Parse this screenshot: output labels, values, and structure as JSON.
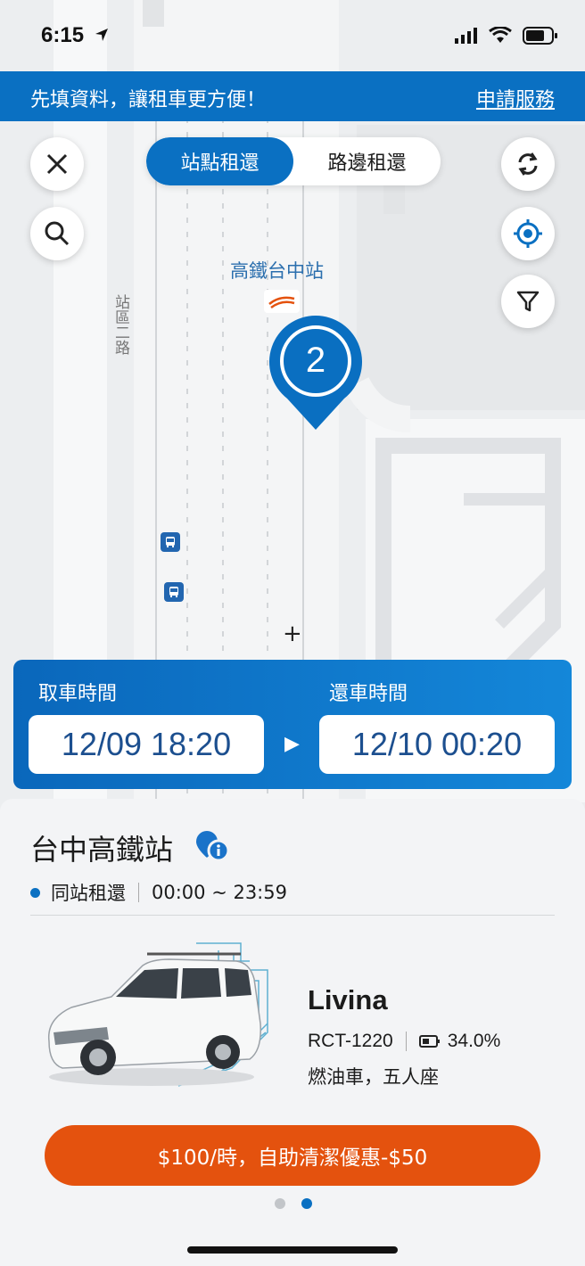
{
  "status_bar": {
    "time": "6:15"
  },
  "banner": {
    "message": "先填資料，讓租車更方便！",
    "link": "申請服務"
  },
  "segmented": {
    "option1": "站點租還",
    "option2": "路邊租還"
  },
  "map": {
    "station_label": "高鐵台中站",
    "road_label": "站區二路",
    "cluster_count": "2"
  },
  "time_bar": {
    "pickup_label": "取車時間",
    "pickup_value": "12/09 18:20",
    "return_label": "還車時間",
    "return_value": "12/10 00:20"
  },
  "station": {
    "name": "台中高鐵站",
    "mode": "同站租還",
    "hours": "00:00 ~ 23:59"
  },
  "car": {
    "model": "Livina",
    "plate": "RCT-1220",
    "battery": "34.0%",
    "description": "燃油車，五人座"
  },
  "promo": {
    "label": "$100/時，自助清潔優惠-$50"
  },
  "pager": {
    "total": 2,
    "active": 2
  },
  "colors": {
    "brand_blue": "#0a70c2",
    "promo_orange": "#e4520e"
  }
}
